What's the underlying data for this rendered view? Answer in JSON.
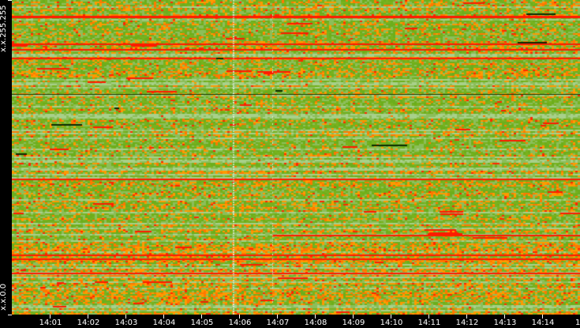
{
  "chart_data": {
    "type": "heatmap",
    "title": "",
    "xlabel": "",
    "ylabel": "",
    "x_tick_labels": [
      "14:01",
      "14:02",
      "14:03",
      "14:04",
      "14:05",
      "14:06",
      "14:07",
      "14:08",
      "14:09",
      "14:10",
      "14:11",
      "14:12",
      "14:13",
      "14:14",
      "14"
    ],
    "y_tick_labels": [
      "x.x.255.255",
      "x.x.0.0"
    ],
    "y_range": [
      "x.x.0.0",
      "x.x.255.255"
    ],
    "color_scale": {
      "low": "#a8d08a",
      "mid": "#6cae1c",
      "high": "#ff9a00",
      "max": "#ff1a00"
    },
    "grid": false
  }
}
